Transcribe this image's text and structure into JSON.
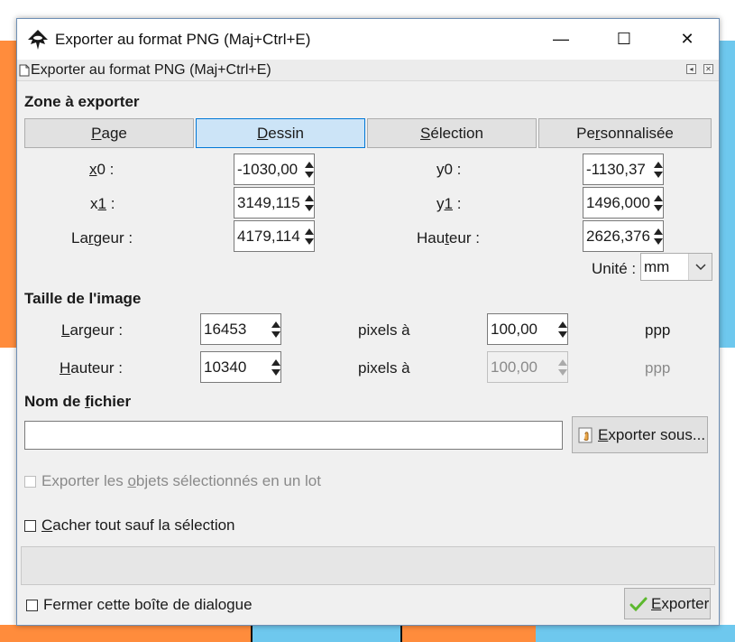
{
  "window": {
    "title": "Exporter au format PNG (Maj+Ctrl+E)",
    "controls": {
      "minimize": "—",
      "maximize": "☐",
      "close": "✕"
    }
  },
  "dock": {
    "title": "Exporter au format PNG (Maj+Ctrl+E)"
  },
  "zone": {
    "title": "Zone à exporter",
    "buttons": [
      {
        "pre": "",
        "ul": "P",
        "post": "age"
      },
      {
        "pre": "",
        "ul": "D",
        "post": "essin"
      },
      {
        "pre": "",
        "ul": "S",
        "post": "élection"
      },
      {
        "pre": "Pe",
        "ul": "r",
        "post": "sonnalisée"
      }
    ],
    "active": "Dessin",
    "x0": {
      "pre": "",
      "ul": "x",
      "post": "0 :",
      "value": "-1030,00"
    },
    "x1": {
      "pre": "x",
      "ul": "1",
      "post": " :",
      "value": "3149,115"
    },
    "width": {
      "pre": "La",
      "ul": "r",
      "post": "geur :",
      "value": "4179,114"
    },
    "y0": {
      "pre": "y0 :",
      "value": "-1130,37"
    },
    "y1": {
      "pre": "y",
      "ul": "1",
      "post": " :",
      "value": "1496,000"
    },
    "height": {
      "pre": "Hau",
      "ul": "t",
      "post": "eur :",
      "value": "2626,376"
    },
    "unit_label": "Unité :",
    "unit_value": "mm"
  },
  "image_size": {
    "title": "Taille de l'image",
    "width_label": {
      "pre": "",
      "ul": "L",
      "post": "argeur :"
    },
    "width_value": "16453",
    "height_label": {
      "pre": "",
      "ul": "H",
      "post": "auteur :"
    },
    "height_value": "10340",
    "pixels_at": "pixels à",
    "dpi_value": "100,00",
    "dpi_value_disabled": "100,00",
    "ppp": "ppp"
  },
  "filename": {
    "title_pre": "Nom de ",
    "title_ul": "f",
    "title_post": "ichier",
    "value": "",
    "export_as": {
      "pre": "",
      "ul": "E",
      "post": "xporter sous..."
    }
  },
  "options": {
    "batch": {
      "pre": "Exporter les ",
      "ul": "o",
      "post": "bjets sélectionnés en un lot"
    },
    "hide": {
      "pre": "",
      "ul": "C",
      "post": "acher tout sauf la sélection"
    },
    "close_dialog": "Fermer cette boîte de dialogue"
  },
  "export_button": {
    "pre": "",
    "ul": "E",
    "post": "xporter"
  },
  "colors": {
    "active_tab": "#cce4f7",
    "active_border": "#0078d7",
    "orange": "#ff8c3c",
    "blue": "#6ec8ee"
  }
}
